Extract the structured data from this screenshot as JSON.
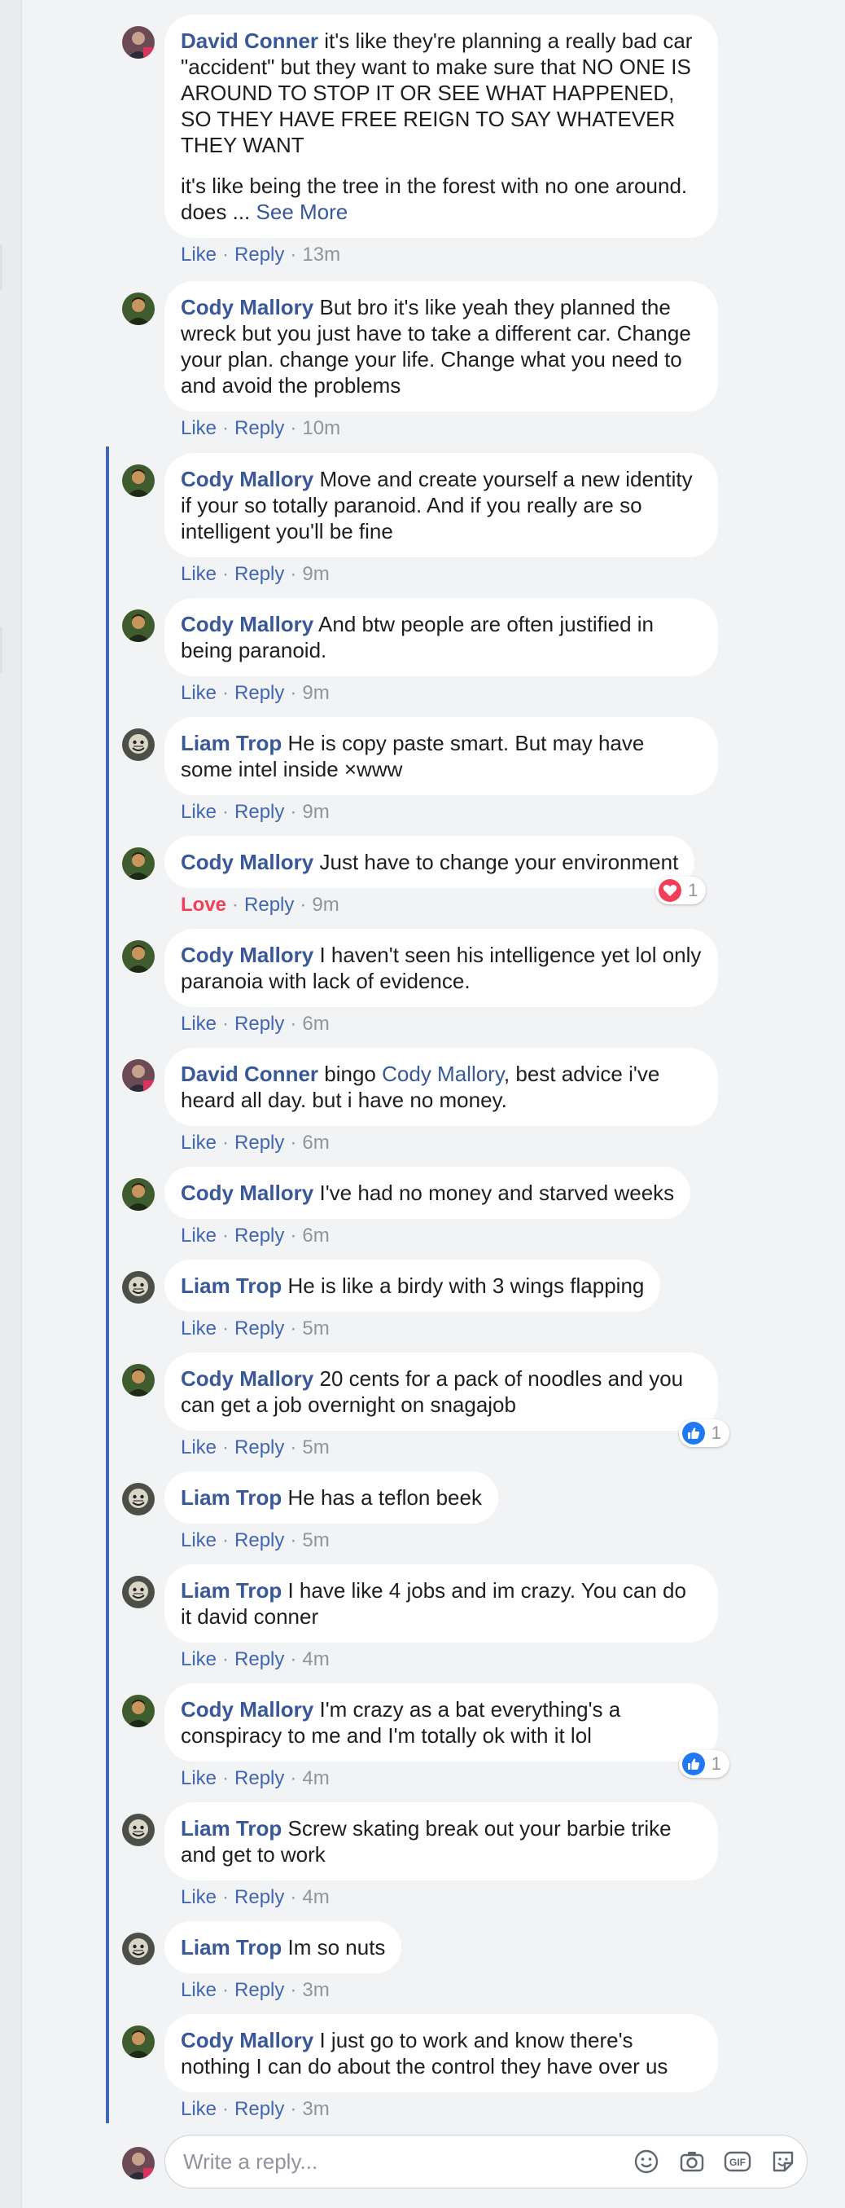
{
  "composer": {
    "placeholder": "Write a reply..."
  },
  "action_labels": {
    "like": "Like",
    "love": "Love",
    "reply": "Reply"
  },
  "comments": [
    {
      "author": "David Conner",
      "text": "it's like they're planning a really bad car \"accident\" but they want to make sure that NO ONE IS AROUND TO STOP IT OR SEE WHAT HAPPENED, SO THEY HAVE FREE REIGN TO SAY WHATEVER THEY WANT",
      "text2": "it's like being the tree in the forest with no one around. does ...",
      "see_more": "See More",
      "time": "13m",
      "avatar": "david"
    },
    {
      "author": "Cody Mallory",
      "text": "But bro it's like yeah they planned the wreck but you just have to take a different car. Change your plan. change your life. Change what you need to and avoid the problems",
      "time": "10m",
      "avatar": "cody"
    },
    {
      "author": "Cody Mallory",
      "text": "Move and create yourself a new identity if your so totally paranoid. And if you really are so intelligent you'll be fine",
      "time": "9m",
      "avatar": "cody"
    },
    {
      "author": "Cody Mallory",
      "text": "And btw people are often justified in being paranoid.",
      "time": "9m",
      "avatar": "cody"
    },
    {
      "author": "Liam Trop",
      "text": "He is copy paste smart. But may have some intel inside ×www",
      "time": "9m",
      "avatar": "liam"
    },
    {
      "author": "Cody Mallory",
      "text": "Just have to change your environment",
      "time": "9m",
      "avatar": "cody",
      "reaction": {
        "type": "love-icon",
        "count": "1"
      }
    },
    {
      "author": "Cody Mallory",
      "text": "I haven't seen his intelligence yet lol only paranoia with lack of evidence.",
      "time": "6m",
      "avatar": "cody"
    },
    {
      "author": "David Conner",
      "text_pre": "bingo",
      "mention": "Cody Mallory",
      "text": ", best advice i've heard all day. but i have no money.",
      "time": "6m",
      "avatar": "david"
    },
    {
      "author": "Cody Mallory",
      "text": "I've had no money and starved weeks",
      "time": "6m",
      "avatar": "cody"
    },
    {
      "author": "Liam Trop",
      "text": "He is like a birdy with 3 wings flapping",
      "time": "5m",
      "avatar": "liam"
    },
    {
      "author": "Cody Mallory",
      "text": "20 cents for a pack of noodles and you can get a job overnight on snagajob",
      "time": "5m",
      "avatar": "cody",
      "reaction": {
        "type": "like-icon",
        "count": "1"
      }
    },
    {
      "author": "Liam Trop",
      "text": "He has a teflon beek",
      "time": "5m",
      "avatar": "liam"
    },
    {
      "author": "Liam Trop",
      "text": "I have like 4 jobs and im crazy. You can do it david conner",
      "time": "4m",
      "avatar": "liam"
    },
    {
      "author": "Cody Mallory",
      "text": "I'm crazy as a bat everything's a conspiracy to me and I'm totally ok with it lol",
      "time": "4m",
      "avatar": "cody",
      "reaction": {
        "type": "like-icon",
        "count": "1"
      }
    },
    {
      "author": "Liam Trop",
      "text": "Screw skating break out your barbie trike and get to work",
      "time": "4m",
      "avatar": "liam"
    },
    {
      "author": "Liam Trop",
      "text": "Im so nuts",
      "time": "3m",
      "avatar": "liam"
    },
    {
      "author": "Cody Mallory",
      "text": "I just go to work and know there's nothing I can do about the control they have over us",
      "time": "3m",
      "avatar": "cody"
    }
  ],
  "colors": {
    "link_blue": "#385898",
    "thread_line": "#4267b2",
    "love_red": "#f33e58",
    "bubble_bg": "#ffffff",
    "page_bg": "#f2f3f5"
  }
}
